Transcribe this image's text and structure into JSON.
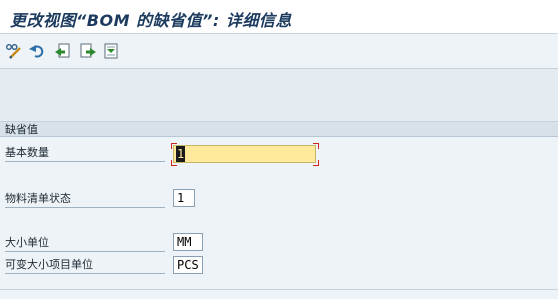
{
  "window": {
    "title": "更改视图“BOM 的缺省值”: 详细信息"
  },
  "toolbar": {
    "icons": [
      "display-change-icon",
      "undo-icon",
      "previous-entry-icon",
      "next-entry-icon",
      "select-entry-icon"
    ]
  },
  "group": {
    "title": "缺省值"
  },
  "fields": {
    "base_quantity": {
      "label": "基本数量",
      "value": "1"
    },
    "bom_status": {
      "label": "物料清单状态",
      "value": "1"
    },
    "size_unit": {
      "label": "大小单位",
      "value": "MM"
    },
    "variable_size_unit": {
      "label": "可变大小项目单位",
      "value": "PCS"
    }
  },
  "colors": {
    "focus_field": "#ffe99b",
    "focus_corner": "#d0241f",
    "title": "#1c3b5e"
  }
}
